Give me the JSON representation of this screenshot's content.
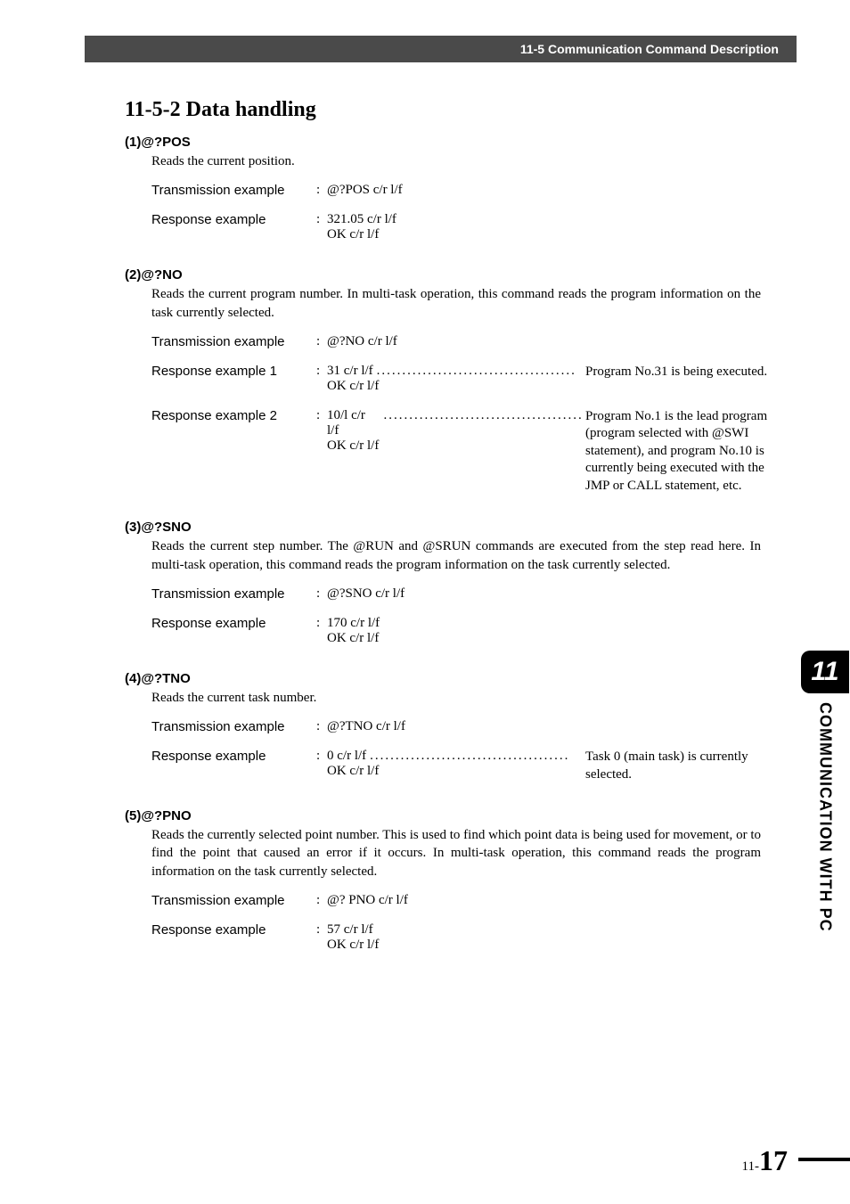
{
  "header": {
    "title": "11-5 Communication Command Description"
  },
  "section": {
    "title": "11-5-2  Data handling"
  },
  "sub1": {
    "num": "(1)",
    "cmd": "@?POS",
    "desc": "Reads the current position.",
    "tx_label": "Transmission example",
    "tx_value": "@?POS c/r l/f",
    "rx_label": "Response example",
    "rx_value1": "321.05 c/r l/f",
    "rx_value2": "OK c/r l/f"
  },
  "sub2": {
    "num": "(2)",
    "cmd": "@?NO",
    "desc": "Reads the current program number. In multi-task operation, this command reads the program information on the task currently selected.",
    "tx_label": "Transmission example",
    "tx_value": "@?NO c/r l/f",
    "rx1_label": "Response example 1",
    "rx1_value1": "31 c/r l/f",
    "rx1_value2": "OK c/r l/f",
    "rx1_note": "Program No.31 is being executed.",
    "rx2_label": "Response example 2",
    "rx2_value1": "10/l c/r l/f",
    "rx2_value2": "OK c/r l/f",
    "rx2_note": "Program No.1 is the lead program (program selected with @SWI statement), and program No.10 is currently being executed with the JMP or CALL statement, etc."
  },
  "sub3": {
    "num": "(3)",
    "cmd": "@?SNO",
    "desc": "Reads the current step number. The @RUN and @SRUN commands are executed from the step read here. In multi-task operation, this command reads the program information on the task currently selected.",
    "tx_label": "Transmission example",
    "tx_value": "@?SNO c/r l/f",
    "rx_label": "Response example",
    "rx_value1": "170 c/r l/f",
    "rx_value2": "OK c/r l/f"
  },
  "sub4": {
    "num": "(4)",
    "cmd": "@?TNO",
    "desc": "Reads the current task number.",
    "tx_label": "Transmission example",
    "tx_value": "@?TNO c/r l/f",
    "rx_label": "Response example",
    "rx_value1": "0 c/r l/f",
    "rx_value2": "OK c/r l/f",
    "rx_note": "Task 0 (main task) is currently selected."
  },
  "sub5": {
    "num": "(5)",
    "cmd": "@?PNO",
    "desc": "Reads the currently selected point number. This is used to find which point data is being used for movement, or to find the point that caused an error if it occurs. In multi-task operation, this command reads the program information on the task currently selected.",
    "tx_label": "Transmission example",
    "tx_value": "@? PNO c/r l/f",
    "rx_label": "Response example",
    "rx_value1": "57 c/r l/f",
    "rx_value2": "OK c/r l/f"
  },
  "sidebar": {
    "chapter": "11",
    "title": "COMMUNICATION WITH PC"
  },
  "page": {
    "prefix": "11-",
    "number": "17"
  },
  "dots": "......................................."
}
